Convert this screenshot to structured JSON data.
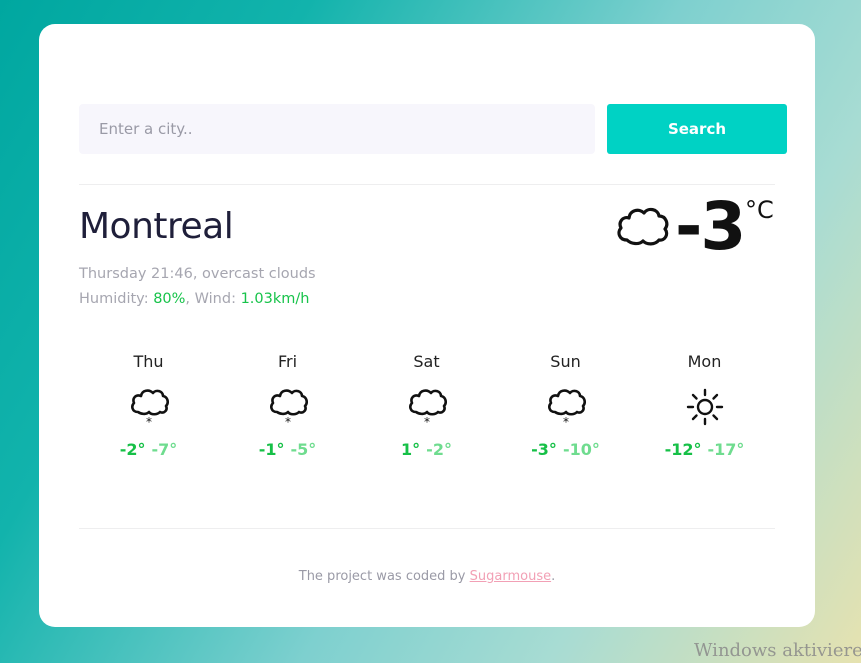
{
  "search": {
    "placeholder": "Enter a city..",
    "button_label": "Search"
  },
  "current": {
    "city": "Montreal",
    "description": "Thursday 21:46, overcast clouds",
    "humidity_label": "Humidity: ",
    "humidity_value": "80%",
    "wind_label": ", Wind: ",
    "wind_value": "1.03km/h",
    "temperature": "-3",
    "unit": "°C",
    "icon": "cloud-icon"
  },
  "forecast": [
    {
      "day": "Thu",
      "icon": "snow-cloud-icon",
      "high": "-2°",
      "low": "-7°"
    },
    {
      "day": "Fri",
      "icon": "snow-cloud-icon",
      "high": "-1°",
      "low": "-5°"
    },
    {
      "day": "Sat",
      "icon": "snow-cloud-icon",
      "high": "1°",
      "low": "-2°"
    },
    {
      "day": "Sun",
      "icon": "snow-cloud-icon",
      "high": "-3°",
      "low": "-10°"
    },
    {
      "day": "Mon",
      "icon": "sun-icon",
      "high": "-12°",
      "low": "-17°"
    }
  ],
  "footer": {
    "text": "The project was coded by ",
    "link": "Sugarmouse",
    "suffix": "."
  },
  "watermark": "Windows aktivieren",
  "colors": {
    "accent": "#00d2c4",
    "high_temp": "#16c047",
    "low_temp": "#6fdc8f",
    "link": "#f2a0b5"
  }
}
